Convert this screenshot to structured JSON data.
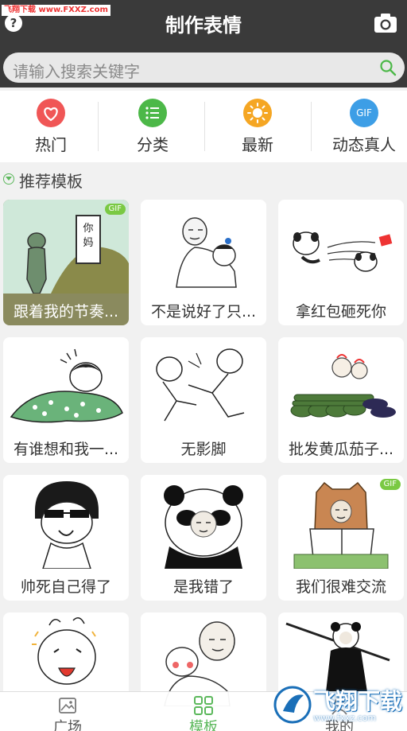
{
  "watermark_top": "飞翔下载 www.FXXZ.com",
  "header": {
    "help_label": "?",
    "title": "制作表情"
  },
  "search": {
    "placeholder": "请输入搜索关键字"
  },
  "categories": [
    {
      "label": "热门",
      "icon": "heart-icon",
      "color": "#f05656"
    },
    {
      "label": "分类",
      "icon": "list-icon",
      "color": "#4cb848"
    },
    {
      "label": "最新",
      "icon": "sun-icon",
      "color": "#f5a623"
    },
    {
      "label": "动态真人",
      "icon": "gif-icon",
      "color": "#3d9ee6",
      "badge": "GIF"
    }
  ],
  "section": {
    "title": "推荐模板"
  },
  "templates": [
    {
      "caption": "跟着我的节奏...",
      "gif": "GIF"
    },
    {
      "caption": "不是说好了只..."
    },
    {
      "caption": "拿红包砸死你"
    },
    {
      "caption": "有谁想和我一..."
    },
    {
      "caption": "无影脚"
    },
    {
      "caption": "批发黄瓜茄子..."
    },
    {
      "caption": "帅死自己得了"
    },
    {
      "caption": "是我错了"
    },
    {
      "caption": "我们很难交流",
      "gif": "GIF"
    },
    {
      "caption": ""
    },
    {
      "caption": ""
    },
    {
      "caption": ""
    }
  ],
  "art_text": {
    "tombstone": "你妈"
  },
  "tabbar": [
    {
      "label": "广场",
      "icon": "picture-icon"
    },
    {
      "label": "模板",
      "icon": "grid-icon",
      "active": true
    },
    {
      "label": "我的",
      "icon": "person-icon"
    }
  ],
  "brand_watermark": {
    "text": "飞翔下载",
    "url": "www.fxxz.com"
  },
  "colors": {
    "header": "#3a3a3a",
    "accent": "#5cb85c"
  }
}
